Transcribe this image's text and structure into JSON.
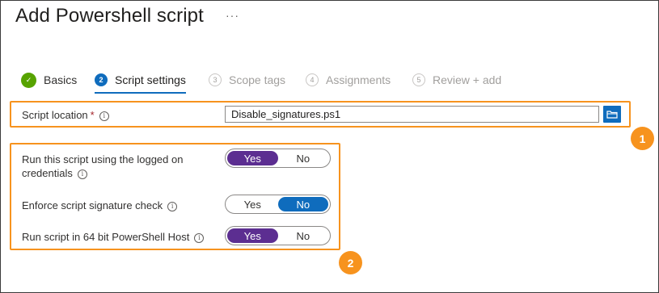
{
  "header": {
    "title": "Add Powershell script",
    "more": "···"
  },
  "tabs": [
    {
      "label": "Basics",
      "num": "✓",
      "state": "done"
    },
    {
      "label": "Script settings",
      "num": "2",
      "state": "active"
    },
    {
      "label": "Scope tags",
      "num": "3",
      "state": "disabled"
    },
    {
      "label": "Assignments",
      "num": "4",
      "state": "disabled"
    },
    {
      "label": "Review + add",
      "num": "5",
      "state": "disabled"
    }
  ],
  "form": {
    "script_location": {
      "label": "Script location",
      "required_mark": "*",
      "info": "i",
      "value": "Disable_signatures.ps1"
    },
    "run_logged_on": {
      "label_line1": "Run this script using the logged on",
      "label_line2": "credentials",
      "info": "i",
      "yes": "Yes",
      "no": "No",
      "selected": "Yes"
    },
    "enforce_signature": {
      "label": "Enforce script signature check",
      "info": "i",
      "yes": "Yes",
      "no": "No",
      "selected": "No"
    },
    "run_64bit": {
      "label": "Run script in 64 bit PowerShell Host",
      "info": "i",
      "yes": "Yes",
      "no": "No",
      "selected": "Yes"
    }
  },
  "callouts": {
    "one": "1",
    "two": "2",
    "color": "#f7931e"
  },
  "colors": {
    "accent": "#0f6cbd",
    "toggle_yes": "#5c2e91",
    "done": "#57a300"
  }
}
